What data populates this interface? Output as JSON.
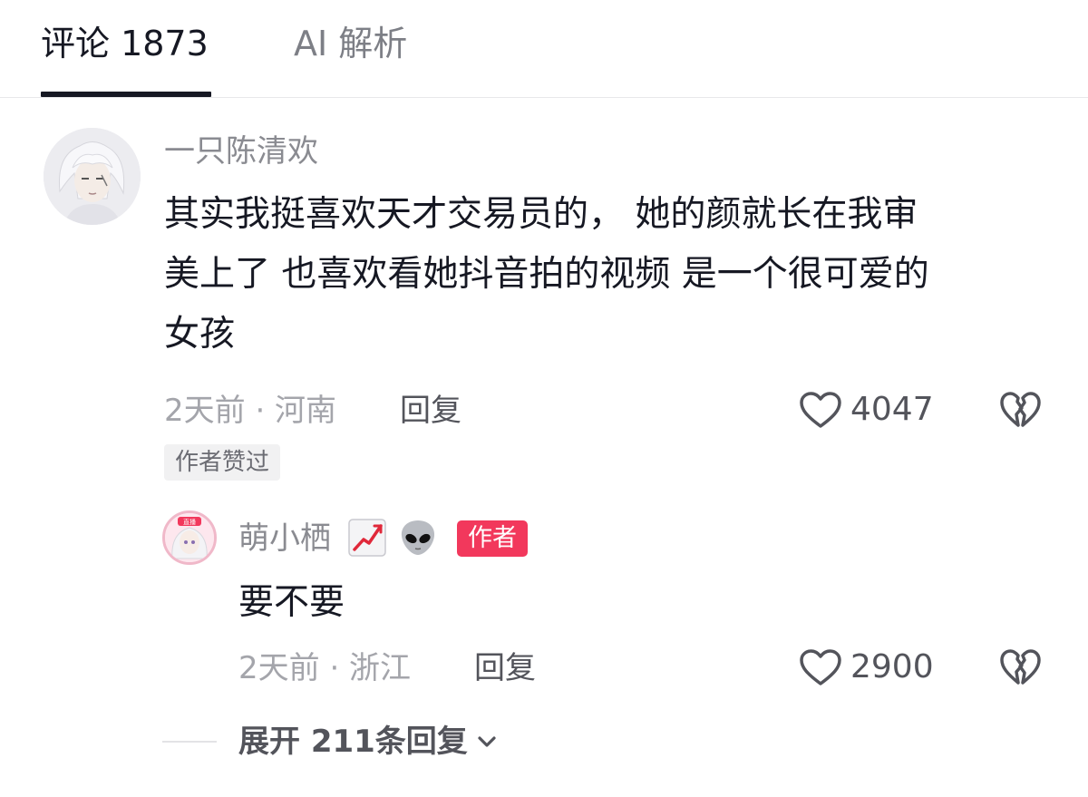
{
  "tabs": [
    {
      "label": "评论 1873",
      "active": true
    },
    {
      "label": "AI 解析",
      "active": false
    }
  ],
  "comment": {
    "username": "一只陈清欢",
    "text_lines": [
      "其实我挺喜欢天才交易员的， 她的颜就长在我审",
      "美上了 也喜欢看她抖音拍的视频 是一个很可爱的",
      "女孩"
    ],
    "time_location": "2天前 · 河南",
    "reply_label": "回复",
    "like_count": "4047",
    "author_liked": "作者赞过"
  },
  "reply": {
    "username": "萌小栖",
    "emojis": [
      "chart-increasing-emoji",
      "alien-emoji"
    ],
    "author_badge": "作者",
    "avatar_badge": "直播",
    "text": "要不要",
    "time_location": "2天前 · 浙江",
    "reply_label": "回复",
    "like_count": "2900"
  },
  "expand_label": "展开 211条回复",
  "colors": {
    "text_primary": "#161823",
    "text_secondary": "#8a8b91",
    "author_badge_bg": "#f2385c"
  }
}
